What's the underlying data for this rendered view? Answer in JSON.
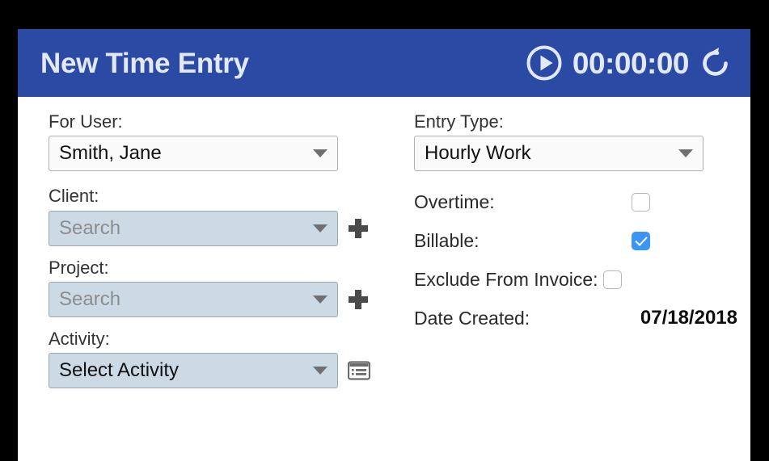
{
  "header": {
    "title": "New Time Entry",
    "timer_value": "00:00:00",
    "play_icon": "play-circle-icon",
    "reset_icon": "reset-arrow-icon",
    "background_color": "#2b4aa4",
    "text_color": "#e2e8f4"
  },
  "form": {
    "left": {
      "for_user": {
        "label": "For User:",
        "value": "Smith, Jane"
      },
      "client": {
        "label": "Client:",
        "placeholder": "Search",
        "value": "Search",
        "add_icon": "plus-icon"
      },
      "project": {
        "label": "Project:",
        "placeholder": "Search",
        "value": "Search",
        "add_icon": "plus-icon"
      },
      "activity": {
        "label": "Activity:",
        "value": "Select Activity",
        "list_icon": "list-detail-icon"
      }
    },
    "right": {
      "entry_type": {
        "label": "Entry Type:",
        "value": "Hourly Work"
      },
      "overtime": {
        "label": "Overtime:",
        "checked": false
      },
      "billable": {
        "label": "Billable:",
        "checked": true
      },
      "exclude_from_invoice": {
        "label": "Exclude From Invoice:",
        "checked": false
      },
      "date_created": {
        "label": "Date Created:",
        "value": "07/18/2018"
      }
    }
  },
  "colors": {
    "accent_blue": "#2b4aa4",
    "checkbox_blue": "#3b95f5",
    "field_blue": "#ccdae6",
    "field_white": "#fafafa"
  }
}
